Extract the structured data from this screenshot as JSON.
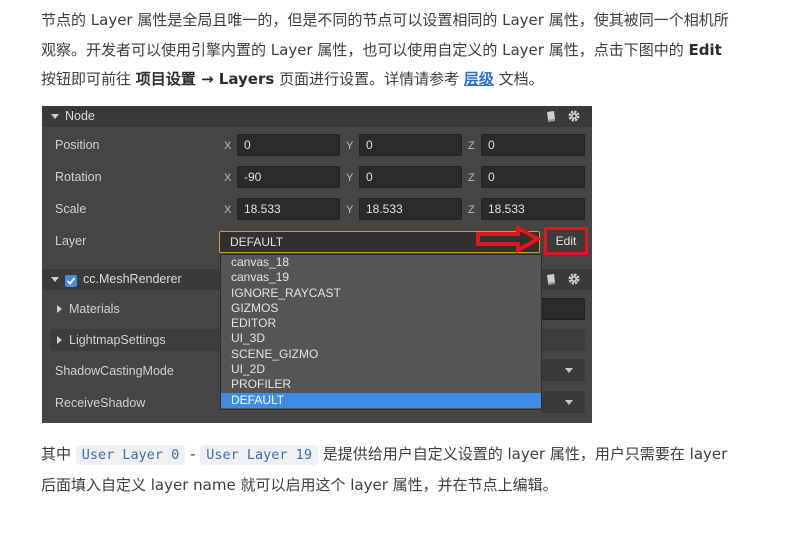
{
  "intro": {
    "part1": "节点的 Layer 属性是全局且唯一的，但是不同的节点可以设置相同的 Layer 属性，使其被同一个相机所观察。开发者可以使用引擎内置的 Layer 属性，也可以使用自定义的 Layer 属性，点击下图中的 ",
    "edit_word": "Edit",
    "part2": " 按钮即可前往 ",
    "project_settings": "项目设置 → Layers",
    "part3": " 页面进行设置。详情请参考 ",
    "link_text": "层级",
    "part4": " 文档。"
  },
  "inspector": {
    "node_header": "Node",
    "position": {
      "label": "Position",
      "x": "0",
      "y": "0",
      "z": "0"
    },
    "rotation": {
      "label": "Rotation",
      "x": "-90",
      "y": "0",
      "z": "0"
    },
    "scale": {
      "label": "Scale",
      "x": "18.533",
      "y": "18.533",
      "z": "18.533"
    },
    "axis_labels": {
      "x": "X",
      "y": "Y",
      "z": "Z"
    },
    "layer": {
      "label": "Layer",
      "value": "DEFAULT",
      "edit_label": "Edit"
    },
    "dropdown_options": [
      "canvas_18",
      "canvas_19",
      "IGNORE_RAYCAST",
      "GIZMOS",
      "EDITOR",
      "UI_3D",
      "SCENE_GIZMO",
      "UI_2D",
      "PROFILER",
      "DEFAULT"
    ],
    "dropdown_selected": "DEFAULT",
    "mesh_renderer": "cc.MeshRenderer",
    "materials": "Materials",
    "lightmap": "LightmapSettings",
    "shadow_casting": "ShadowCastingMode",
    "receive_shadow": "ReceiveShadow"
  },
  "outro": {
    "part1": "其中 ",
    "code1": "User Layer 0",
    "dash": " - ",
    "code2": "User Layer 19",
    "part2": " 是提供给用户自定义设置的 layer 属性，用户只需要在 layer 后面填入自定义 layer name 就可以启用这个 layer 属性，并在节点上编辑。"
  },
  "colors": {
    "accent": "#3f8ce8",
    "highlight_red": "#e2141c",
    "link": "#2f6fd0",
    "code_text": "#3e6bb8"
  }
}
